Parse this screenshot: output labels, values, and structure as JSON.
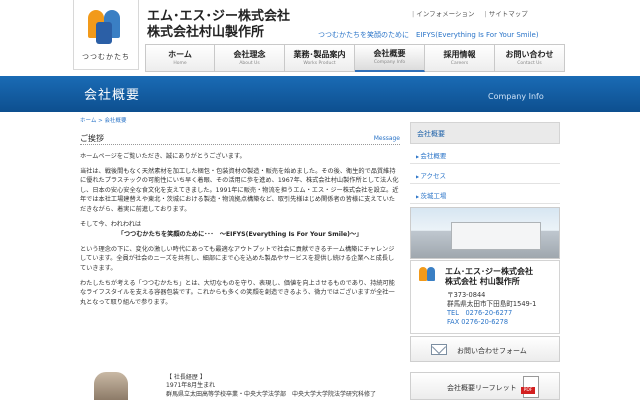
{
  "header": {
    "logo_caption": "つつむかたち",
    "company_name_1": "エム･エス･ジー株式会社",
    "company_name_2": "株式会社村山製作所",
    "top_links": [
      "インフォメーション",
      "サイトマップ"
    ],
    "slogan": "つつむかたちを笑顔のために　EIFYS(Everything Is For Your Smile)"
  },
  "nav": [
    {
      "jp": "ホーム",
      "en": "Home"
    },
    {
      "jp": "会社理念",
      "en": "About Us"
    },
    {
      "jp": "業務･製品案内",
      "en": "Works Product"
    },
    {
      "jp": "会社概要",
      "en": "Company Info"
    },
    {
      "jp": "採用情報",
      "en": "Careers"
    },
    {
      "jp": "お問い合わせ",
      "en": "Contact Us"
    }
  ],
  "banner": {
    "title": "会社概要",
    "en": "Company Info"
  },
  "breadcrumb": "ホーム > 会社概要",
  "section": {
    "title": "ご挨拶",
    "en": "Message"
  },
  "body": {
    "p1": "ホームページをご覧いただき、誠にありがとうございます。",
    "p2": "当社は、戦後間もなく天然素材を加工した梱包・包装資材の製造・販売を始めました。その後、衛生的で品質維持に優れたプラスチックの可能性にいち早く着眼、その活用に歩を進め、1967年、株式会社村山製作所として法人化し、日本の安心安全な食文化を支えてきました。1991年に販売・物流を担うエム・エス・ジー株式会社を設立。近年では本社工場建替えや東北・茨城における製造・物流拠点構築など、取引先様はじめ関係者の皆様に支えていただきながら、着実に前進しております。",
    "p3": "そして今、われわれは",
    "quote": "「つつむかたちを笑顔のために･･･　～EIFYS(Everything Is For Your Smile)～」",
    "p4": "という理念の下に、変化の激しい時代にあっても最適なアウトプットで社会に貢献できるチーム構築にチャレンジしています。全員が社会のニーズを共有し、細部にまで心を込めた製品やサービスを提供し続ける企業へと成長していきます。",
    "p5": "わたしたちが考える「つつむかたち」とは、大切なものを守り、表現し、価値を向上させるものであり、持続可能なライフスタイルを支える容器包装です。これからも多くの笑顔を創造できるよう、微力ではございますが全社一丸となって取り組んで参ります。"
  },
  "profile": {
    "label": "【 社長経歴 】",
    "line1": "1971年8月生まれ",
    "line2": "群馬県立太田高等学校卒業・中央大学法学部　中央大学大学院法学研究科修了"
  },
  "sidebar": {
    "head": "会社概要",
    "items": [
      "会社概要",
      "アクセス",
      "茨城工場"
    ]
  },
  "address": {
    "name_1": "エム･エス･ジー株式会社",
    "name_2": "株式会社 村山製作所",
    "zip": "〒373-0844",
    "addr": "群馬県太田市下田島町1549-1",
    "tel": "TEL　0276-20-6277",
    "fax": "FAX 0276-20-6278"
  },
  "contact_label": "お問い合わせフォーム",
  "leaflet_label": "会社概要リーフレット",
  "pdf_tag": "PDF"
}
